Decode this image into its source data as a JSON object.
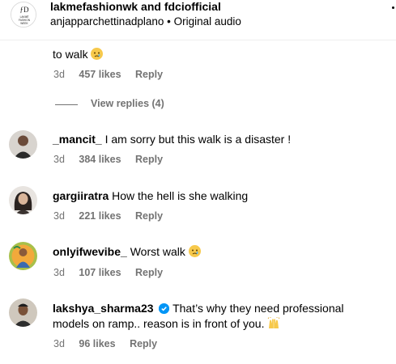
{
  "header": {
    "title": "lakmefashionwk and fdciofficial",
    "subtitle": "anjapparchettinadplano • Original audio",
    "logo_text": "LAKMĒ FASHION WEEK"
  },
  "comments": [
    {
      "text": "to walk",
      "emoji": "crying-face",
      "age": "3d",
      "likes": "457 likes",
      "reply": "Reply",
      "view_replies": "View replies (4)"
    },
    {
      "username": "_mancit_",
      "text": "I am sorry but this walk is a disaster !",
      "age": "3d",
      "likes": "384 likes",
      "reply": "Reply"
    },
    {
      "username": "gargiiratra",
      "text": "How the hell is she walking",
      "age": "3d",
      "likes": "221 likes",
      "reply": "Reply"
    },
    {
      "username": "onlyifwevibe_",
      "text": "Worst walk",
      "emoji": "crying-face",
      "age": "3d",
      "likes": "107 likes",
      "reply": "Reply"
    },
    {
      "username": "lakshya_sharma23",
      "verified": true,
      "text_line1": "That’s why they need professional",
      "text_line2": "models on ramp.. reason is in front of you.",
      "emoji": "raising-hands",
      "age": "3d",
      "likes": "96 likes",
      "reply": "Reply"
    }
  ],
  "colors": {
    "secondary_text": "#737373",
    "verified_blue": "#0095f6",
    "divider": "#efefef"
  }
}
